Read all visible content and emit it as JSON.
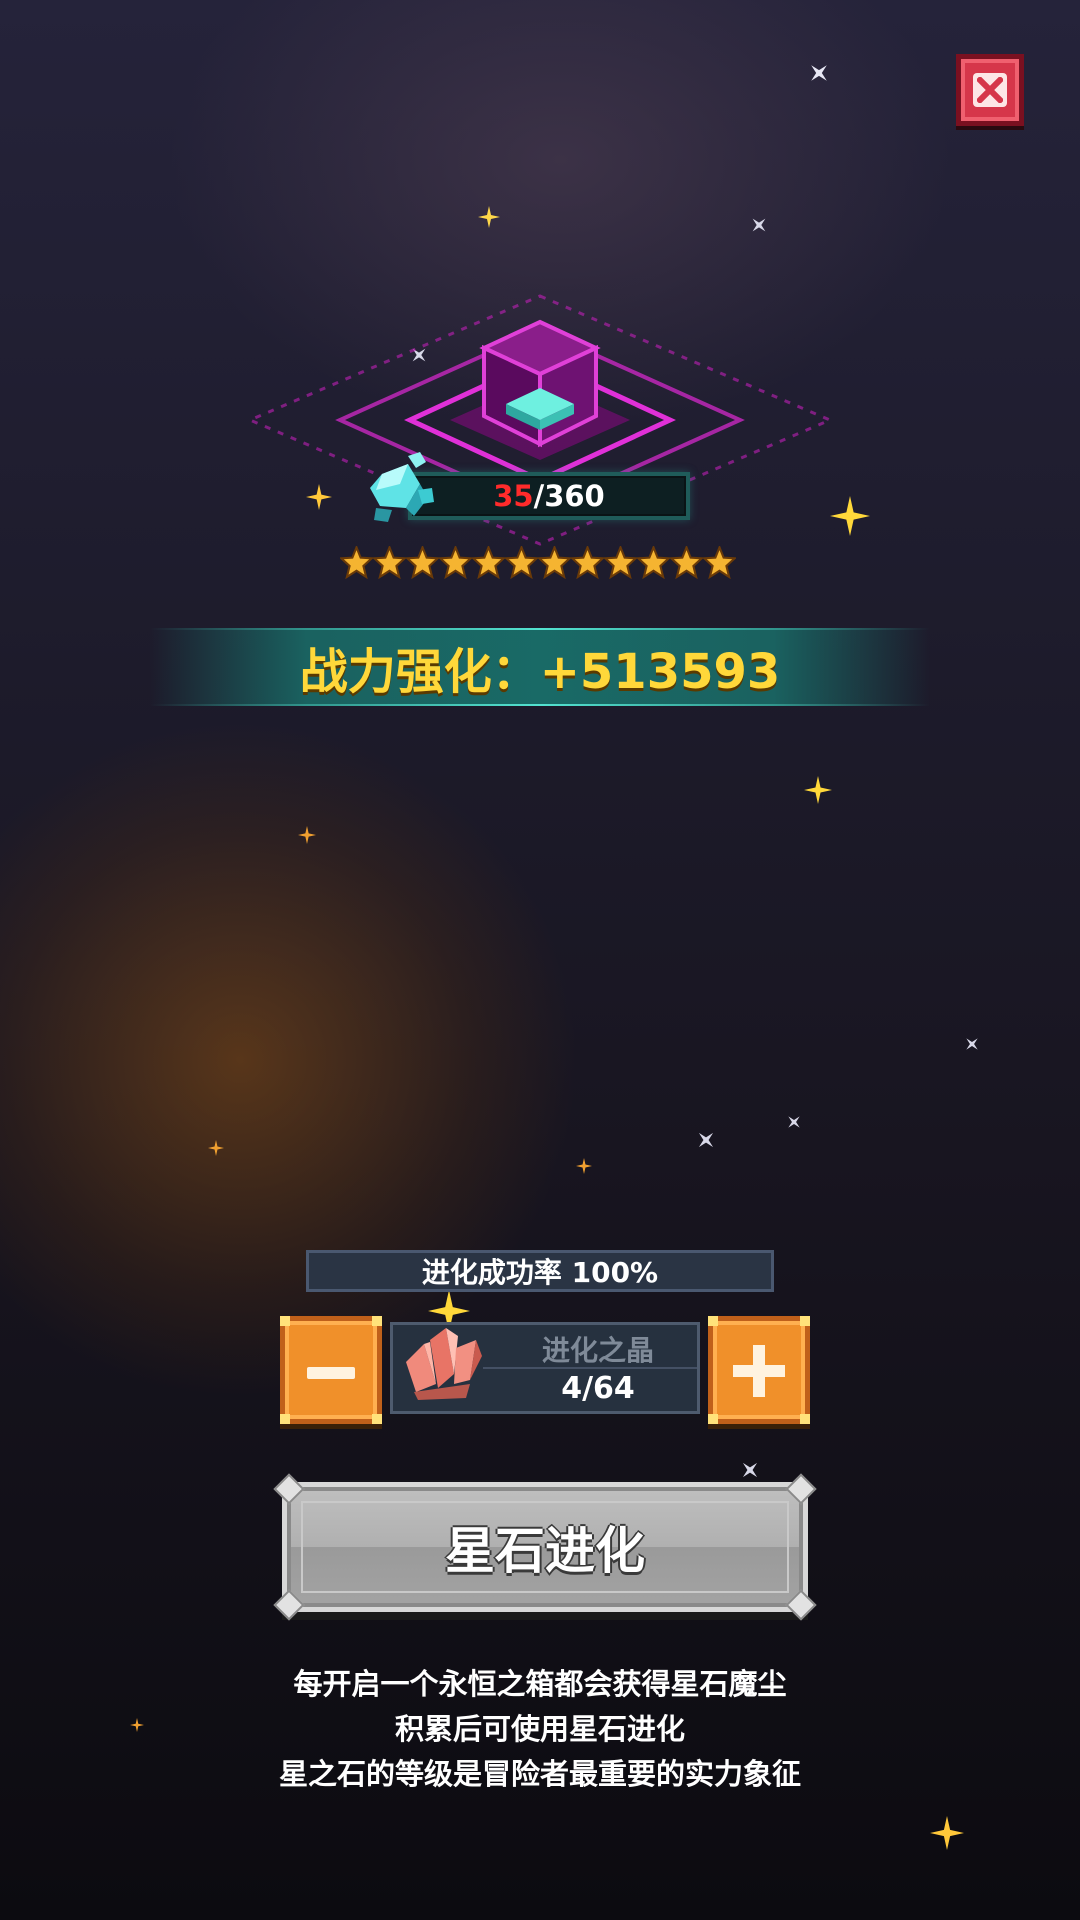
{
  "close_button": {
    "icon": "close-x-icon",
    "color": "#d6364a"
  },
  "progress": {
    "current": "35",
    "separator": "/",
    "max": "360",
    "current_color": "#ff2b2b"
  },
  "stars": {
    "count": 12,
    "color": "#f5b431"
  },
  "power": {
    "text": "战力强化：+513593"
  },
  "success_rate": {
    "text": "进化成功率 100%"
  },
  "item": {
    "name": "进化之晶",
    "count": "4/64",
    "icon": "crystal-icon"
  },
  "buttons": {
    "minus_icon": "minus-icon",
    "plus_icon": "plus-icon",
    "evolve_label": "星石进化"
  },
  "description": {
    "lines": [
      "每开启一个永恒之箱都会获得星石魔尘",
      "积累后可使用星石进化",
      "星之石的等级是冒险者最重要的实力象征"
    ]
  }
}
